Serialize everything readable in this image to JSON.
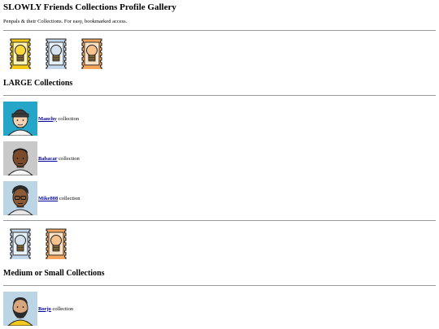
{
  "title": "SLOWLY Friends Collections Profile Gallery",
  "subtitle": "Penpals & their Collections. For easy, bookmarked access.",
  "stamps_top": [
    "lightbulb-stamp-icon",
    "lock-blue-stamp-icon",
    "lock-orange-stamp-icon"
  ],
  "large_section": {
    "heading": "LARGE Collections",
    "friends": [
      {
        "name": "Manchy",
        "suffix": "collection",
        "avatar": "beanie-man-avatar"
      },
      {
        "name": "Babacar",
        "suffix": "collection",
        "avatar": "dark-skin-man-avatar"
      },
      {
        "name": "Mike808",
        "suffix": "collection",
        "avatar": "glasses-man-avatar"
      }
    ]
  },
  "stamps_middle": [
    "lock-blue-stamp-icon",
    "lock-orange-stamp-icon"
  ],
  "medium_section": {
    "heading": "Medium or Small Collections",
    "friends": [
      {
        "name": "Borjo",
        "suffix": "collection",
        "avatar": "bearded-man-avatar"
      }
    ]
  },
  "colors": {
    "link": "#00009c",
    "avatar_bg_teal": "#25a6c9",
    "avatar_bg_gray": "#c9c9c9",
    "avatar_bg_lightblue": "#bcd5e5",
    "stamp_yellow": "#f6c915",
    "stamp_blue": "#c2d7ec",
    "stamp_orange": "#f4a55b"
  }
}
